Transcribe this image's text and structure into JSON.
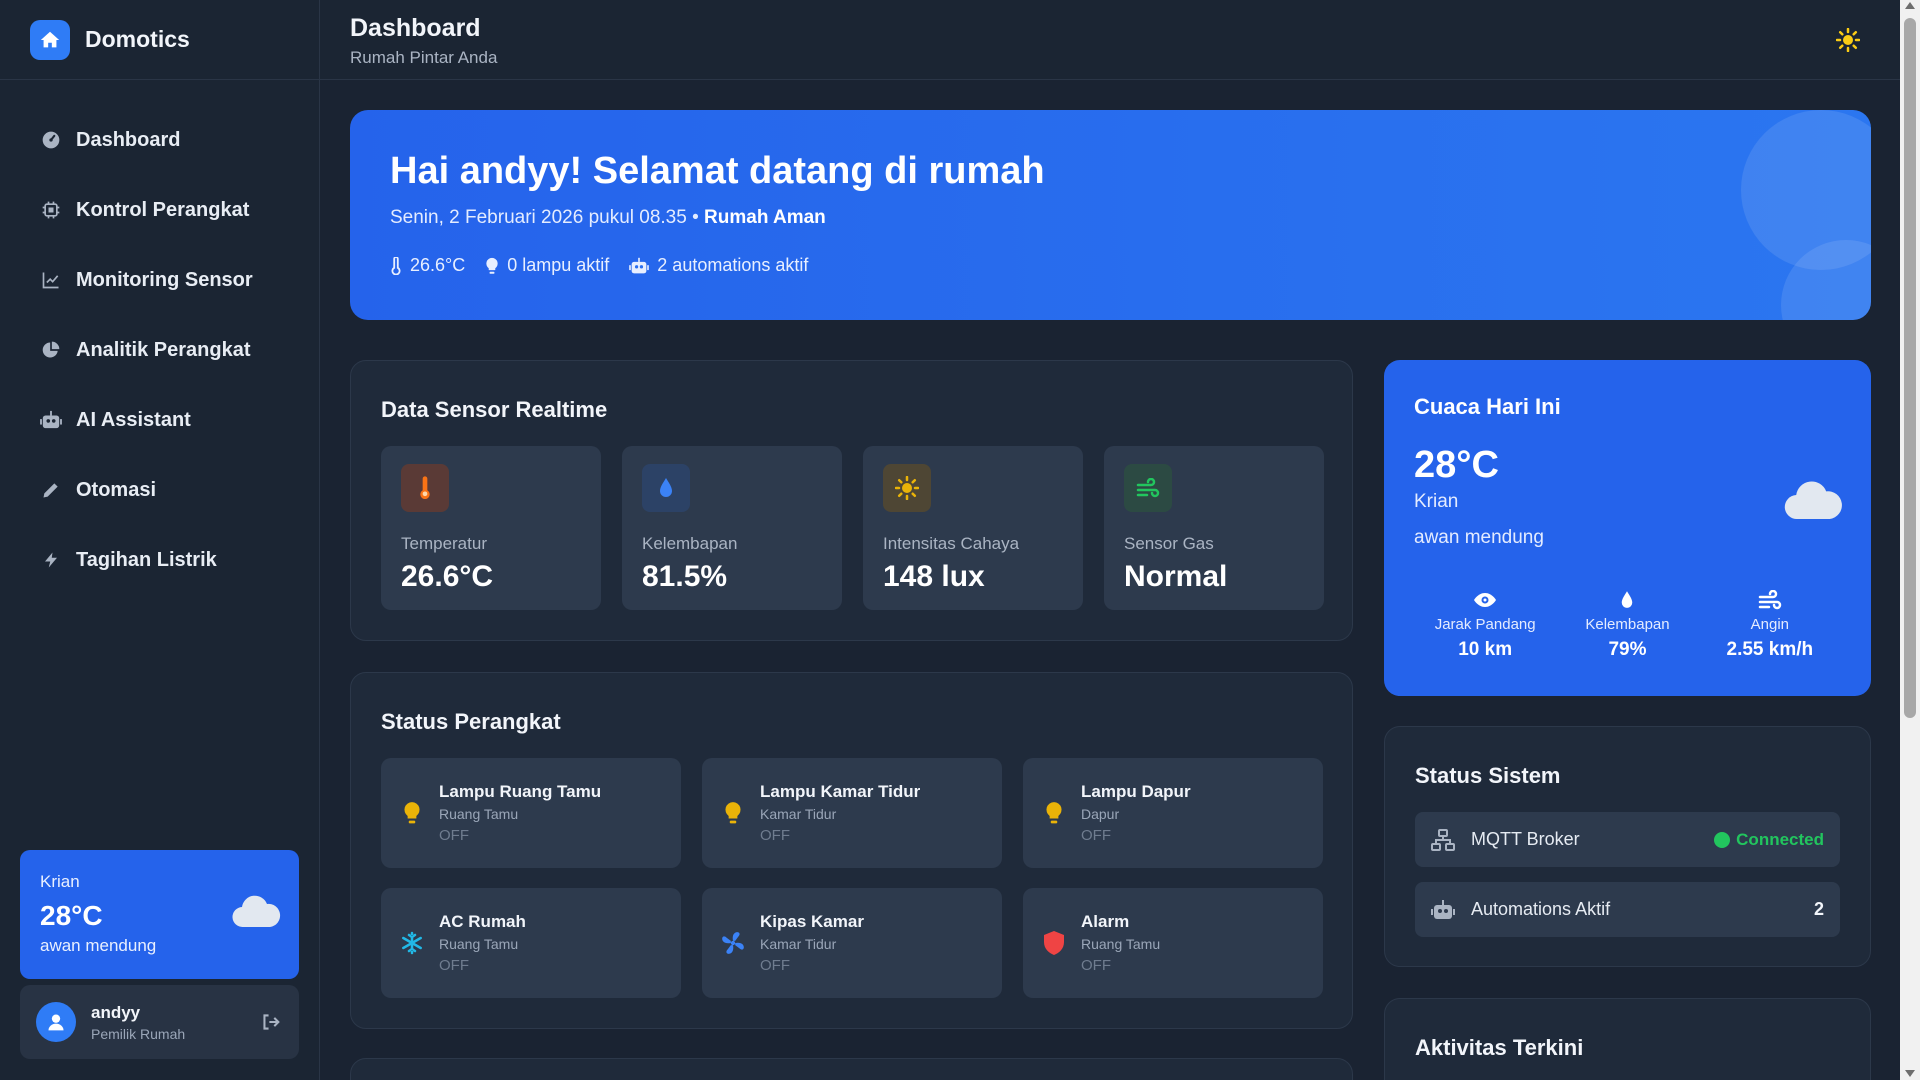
{
  "brand": {
    "name": "Domotics"
  },
  "sidebar": {
    "items": [
      {
        "label": "Dashboard",
        "icon": "gauge-icon"
      },
      {
        "label": "Kontrol Perangkat",
        "icon": "chip-icon"
      },
      {
        "label": "Monitoring Sensor",
        "icon": "line-chart-icon"
      },
      {
        "label": "Analitik Perangkat",
        "icon": "pie-chart-icon"
      },
      {
        "label": "AI Assistant",
        "icon": "robot-icon"
      },
      {
        "label": "Otomasi",
        "icon": "pencil-icon"
      },
      {
        "label": "Tagihan Listrik",
        "icon": "bolt-icon"
      }
    ],
    "weather": {
      "city": "Krian",
      "temp": "28°C",
      "desc": "awan mendung"
    },
    "user": {
      "name": "andyy",
      "role": "Pemilik Rumah"
    }
  },
  "header": {
    "title": "Dashboard",
    "subtitle": "Rumah Pintar Anda"
  },
  "hero": {
    "title": "Hai andyy! Selamat datang di rumah",
    "date": "Senin, 2 Februari 2026 pukul 08.35 •",
    "status": "Rumah Aman",
    "stats": {
      "temp": "26.6°C",
      "lights": "0 lampu aktif",
      "automations": "2 automations aktif"
    }
  },
  "sensors": {
    "title": "Data Sensor Realtime",
    "items": [
      {
        "label": "Temperatur",
        "value": "26.6°C",
        "icon": "thermometer-icon",
        "color": "#f97316"
      },
      {
        "label": "Kelembapan",
        "value": "81.5%",
        "icon": "droplet-icon",
        "color": "#3b82f6"
      },
      {
        "label": "Intensitas Cahaya",
        "value": "148 lux",
        "icon": "sun-icon",
        "color": "#eab308"
      },
      {
        "label": "Sensor Gas",
        "value": "Normal",
        "icon": "wind-icon",
        "color": "#22c55e"
      }
    ]
  },
  "devices": {
    "title": "Status Perangkat",
    "items": [
      {
        "name": "Lampu Ruang Tamu",
        "room": "Ruang Tamu",
        "state": "OFF",
        "icon": "bulb-icon"
      },
      {
        "name": "Lampu Kamar Tidur",
        "room": "Kamar Tidur",
        "state": "OFF",
        "icon": "bulb-icon"
      },
      {
        "name": "Lampu Dapur",
        "room": "Dapur",
        "state": "OFF",
        "icon": "bulb-icon"
      },
      {
        "name": "AC Rumah",
        "room": "Ruang Tamu",
        "state": "OFF",
        "icon": "snowflake-icon"
      },
      {
        "name": "Kipas Kamar",
        "room": "Kamar Tidur",
        "state": "OFF",
        "icon": "fan-icon"
      },
      {
        "name": "Alarm",
        "room": "Ruang Tamu",
        "state": "OFF",
        "icon": "shield-icon"
      }
    ]
  },
  "weather": {
    "title": "Cuaca Hari Ini",
    "temp": "28°C",
    "city": "Krian",
    "desc": "awan mendung",
    "stats": [
      {
        "label": "Jarak Pandang",
        "value": "10 km",
        "icon": "eye-icon"
      },
      {
        "label": "Kelembapan",
        "value": "79%",
        "icon": "droplet-icon"
      },
      {
        "label": "Angin",
        "value": "2.55 km/h",
        "icon": "wind-icon"
      }
    ]
  },
  "system": {
    "title": "Status Sistem",
    "mqtt": {
      "label": "MQTT Broker",
      "status": "Connected"
    },
    "automations": {
      "label": "Automations Aktif",
      "count": "2"
    }
  },
  "activity": {
    "title": "Aktivitas Terkini"
  },
  "colors": {
    "accent": "#2563eb",
    "success": "#22c55e",
    "background": "#1a2332",
    "card": "#2d3a4d"
  }
}
